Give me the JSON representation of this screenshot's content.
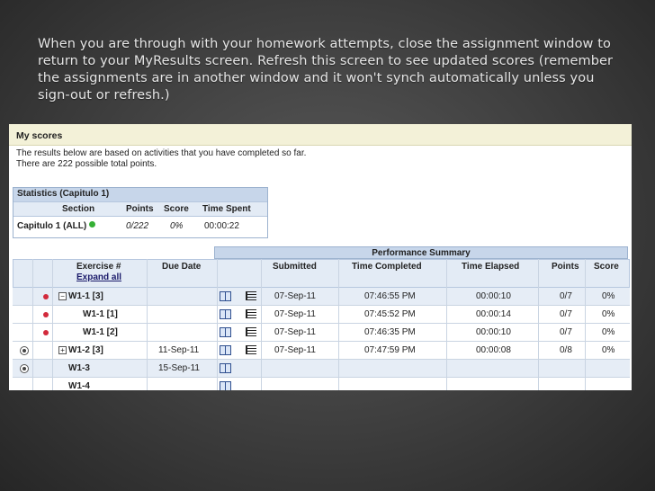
{
  "slide": {
    "caption": "When you are through with your homework attempts, close the assignment window  to return to your MyResults screen.  Refresh this screen to see updated scores (remember the assignments are in another window and it won't synch automatically unless you sign-out or refresh.)"
  },
  "myscores": {
    "title": "My scores",
    "line1": "The results below are based on activities that you have completed so far.",
    "line2": "There are 222 possible total points."
  },
  "statistics": {
    "title": "Statistics (Capitulo 1)",
    "columns": [
      "Section",
      "Points",
      "Score",
      "Time Spent"
    ],
    "row": {
      "section": "Capitulo 1 (ALL)",
      "points": "0/222",
      "score": "0%",
      "time_spent": "00:00:22"
    }
  },
  "performance": {
    "title": "Performance Summary",
    "columns": {
      "exercise": "Exercise #",
      "expand_all": "Expand all",
      "due_date": "Due Date",
      "submitted": "Submitted",
      "time_completed": "Time Completed",
      "time_elapsed": "Time Elapsed",
      "points": "Points",
      "score": "Score"
    },
    "rows": [
      {
        "exercise": "W1-1 [3]",
        "due": "",
        "submitted": "07-Sep-11",
        "completed": "07:46:55 PM",
        "elapsed": "00:00:10",
        "points": "0/7",
        "score": "0%"
      },
      {
        "exercise": "W1-1 [1]",
        "due": "",
        "submitted": "07-Sep-11",
        "completed": "07:45:52 PM",
        "elapsed": "00:00:14",
        "points": "0/7",
        "score": "0%"
      },
      {
        "exercise": "W1-1 [2]",
        "due": "",
        "submitted": "07-Sep-11",
        "completed": "07:46:35 PM",
        "elapsed": "00:00:10",
        "points": "0/7",
        "score": "0%"
      },
      {
        "exercise": "W1-2 [3]",
        "due": "11-Sep-11",
        "submitted": "07-Sep-11",
        "completed": "07:47:59 PM",
        "elapsed": "00:00:08",
        "points": "0/8",
        "score": "0%"
      },
      {
        "exercise": "W1-3",
        "due": "15-Sep-11",
        "submitted": "",
        "completed": "",
        "elapsed": "",
        "points": "",
        "score": ""
      },
      {
        "exercise": "W1-4",
        "due": "",
        "submitted": "",
        "completed": "",
        "elapsed": "",
        "points": "",
        "score": ""
      }
    ]
  },
  "icons": [
    "red-status-dot",
    "green-status-dot",
    "radio-button",
    "collapse-icon",
    "expand-icon",
    "book-icon",
    "list-icon"
  ],
  "colors": {
    "header_blue": "#c7d6ea",
    "row_blue": "#e6edf6",
    "myscores_bg": "#f3f1d8",
    "red_dot": "#d22a3c",
    "green_dot": "#35b035"
  }
}
